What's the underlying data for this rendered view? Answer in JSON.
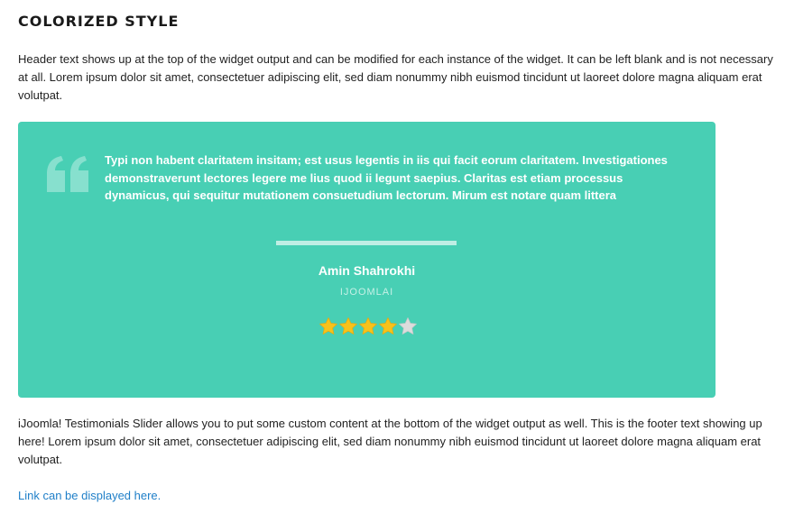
{
  "title": "COLORIZED STYLE",
  "header_text": "Header text shows up at the top of the widget output and can be modified for each instance of the widget. It can be left blank and is not necessary at all. Lorem ipsum dolor sit amet, consectetuer adipiscing elit, sed diam nonummy nibh euismod tincidunt ut laoreet dolore magna aliquam erat volutpat.",
  "testimonial": {
    "background_color": "#48cfb4",
    "quote_icon": "quote-icon",
    "quote": "Typi non habent claritatem insitam; est usus legentis in iis qui facit eorum claritatem. Investigationes demonstraverunt lectores legere me lius quod ii legunt saepius. Claritas est etiam processus dynamicus, qui sequitur mutationem consuetudium lectorum. Mirum est notare quam littera",
    "author_name": "Amin Shahrokhi",
    "author_company": "IJOOMLAI",
    "rating": {
      "value": 4,
      "max": 5,
      "filled_color": "#f7c21b",
      "empty_color": "#dcdcdc",
      "icon": "star-icon"
    }
  },
  "footer_text": "iJoomla! Testimonials Slider allows you to put some custom content at the bottom of the widget output as well. This is the footer text showing up here! Lorem ipsum dolor sit amet, consectetuer adipiscing elit, sed diam nonummy nibh euismod tincidunt ut laoreet dolore magna aliquam erat volutpat.",
  "link_text": "Link can be displayed here.",
  "link_color": "#1f7fc8"
}
